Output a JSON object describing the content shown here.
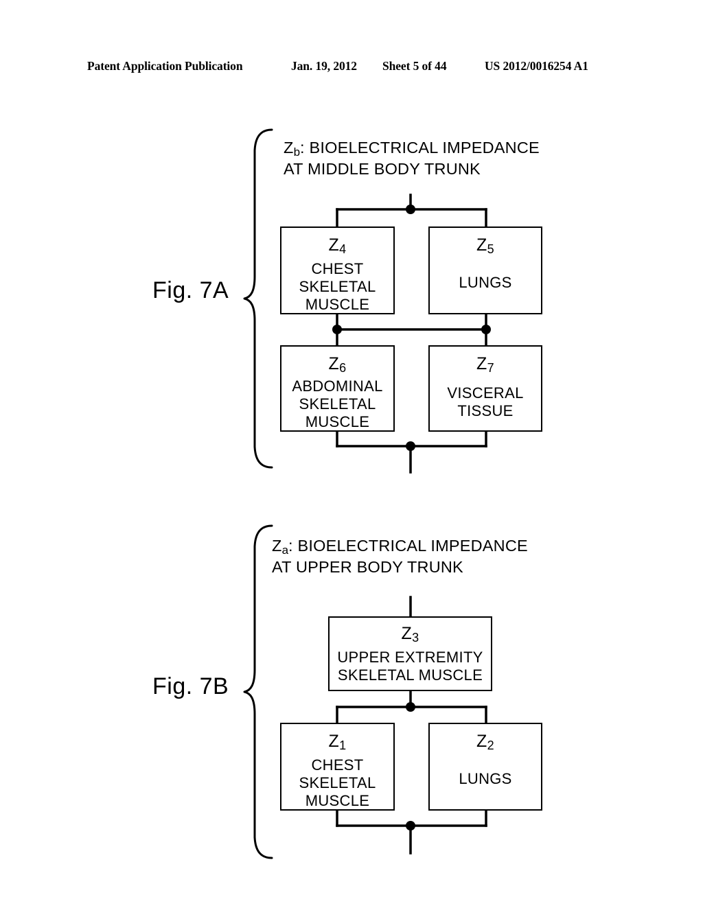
{
  "header": {
    "publication": "Patent Application Publication",
    "date": "Jan. 19, 2012",
    "sheet": "Sheet 5 of 44",
    "number": "US 2012/0016254 A1"
  },
  "figures": [
    {
      "id": "fig-7a",
      "label": "Fig. 7A",
      "title_symbol": "Z",
      "title_subscript": "b",
      "title_line1_rest": ": BIOELECTRICAL IMPEDANCE",
      "title_line2": "AT MIDDLE BODY TRUNK",
      "blocks": [
        {
          "symbol": "Z",
          "subscript": "4",
          "description": "CHEST\nSKELETAL\nMUSCLE"
        },
        {
          "symbol": "Z",
          "subscript": "5",
          "description": "LUNGS"
        },
        {
          "symbol": "Z",
          "subscript": "6",
          "description": "ABDOMINAL\nSKELETAL\nMUSCLE"
        },
        {
          "symbol": "Z",
          "subscript": "7",
          "description": "VISCERAL\nTISSUE"
        }
      ]
    },
    {
      "id": "fig-7b",
      "label": "Fig. 7B",
      "title_symbol": "Z",
      "title_subscript": "a",
      "title_line1_rest": ": BIOELECTRICAL IMPEDANCE",
      "title_line2": "AT UPPER BODY TRUNK",
      "blocks": [
        {
          "symbol": "Z",
          "subscript": "3",
          "description": "UPPER EXTREMITY\nSKELETAL MUSCLE"
        },
        {
          "symbol": "Z",
          "subscript": "1",
          "description": "CHEST\nSKELETAL\nMUSCLE"
        },
        {
          "symbol": "Z",
          "subscript": "2",
          "description": "LUNGS"
        }
      ]
    }
  ],
  "colors": {
    "ink": "#000000",
    "paper": "#ffffff"
  }
}
